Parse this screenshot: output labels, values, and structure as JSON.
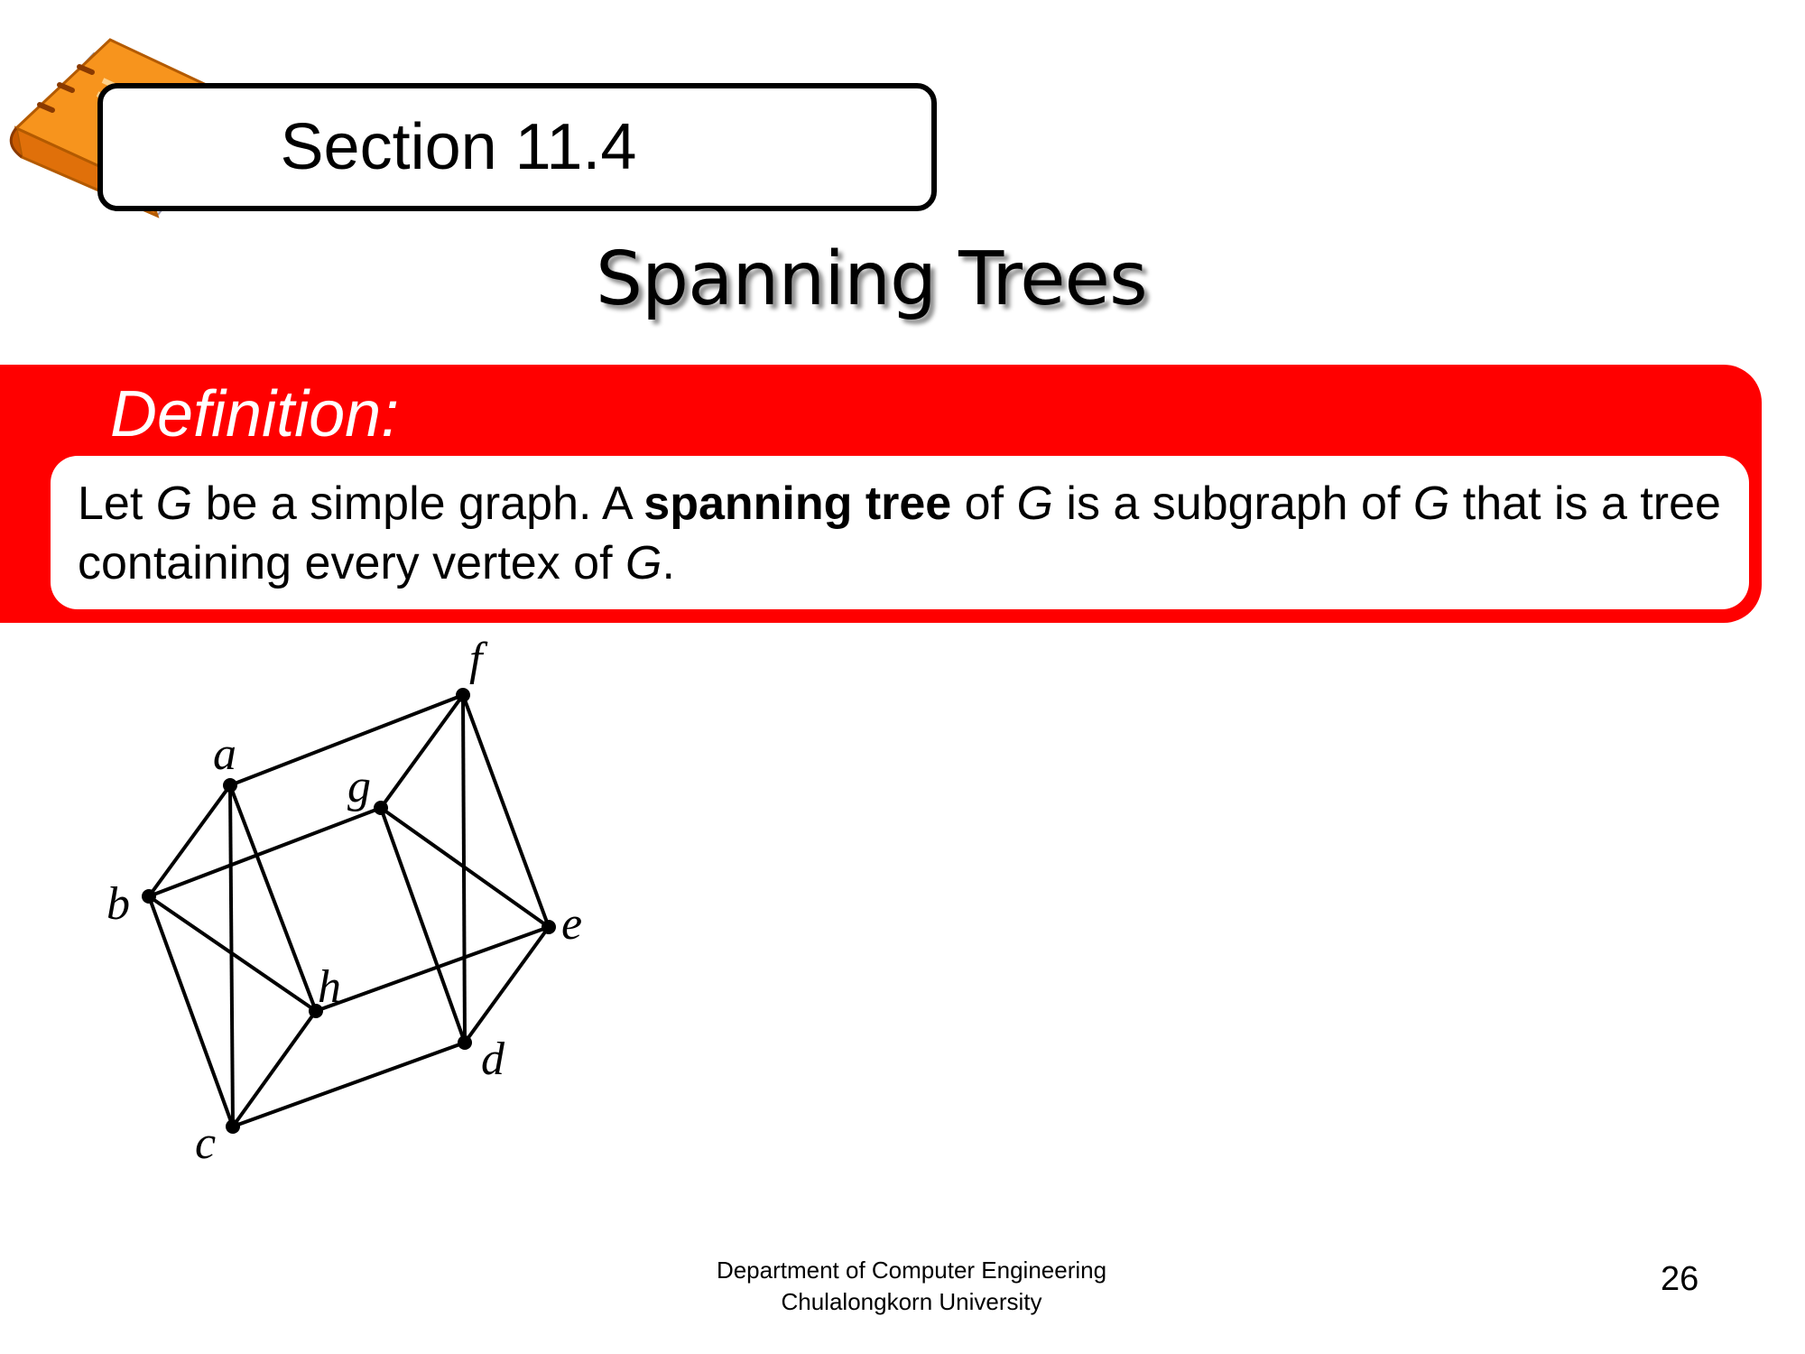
{
  "section_label": "Section 11.4",
  "title": "Spanning Trees",
  "definition": {
    "label": "Definition:",
    "text_parts": {
      "p1": "Let ",
      "g1": "G",
      "p2": " be a simple graph. A ",
      "term": "spanning tree",
      "p3": " of ",
      "g2": "G",
      "p4": " is a subgraph of ",
      "g3": "G",
      "p5": " that is a tree containing every vertex of ",
      "g4": "G",
      "p6": "."
    }
  },
  "graph": {
    "vertices": [
      "a",
      "b",
      "c",
      "d",
      "e",
      "f",
      "g",
      "h"
    ],
    "edges": [
      [
        "a",
        "f"
      ],
      [
        "a",
        "b"
      ],
      [
        "a",
        "c"
      ],
      [
        "a",
        "h"
      ],
      [
        "b",
        "g"
      ],
      [
        "b",
        "h"
      ],
      [
        "b",
        "c"
      ],
      [
        "c",
        "h"
      ],
      [
        "c",
        "d"
      ],
      [
        "d",
        "e"
      ],
      [
        "d",
        "f"
      ],
      [
        "d",
        "g"
      ],
      [
        "e",
        "f"
      ],
      [
        "e",
        "g"
      ],
      [
        "e",
        "h"
      ],
      [
        "f",
        "g"
      ]
    ]
  },
  "footer": {
    "line1": "Department of Computer Engineering",
    "line2": "Chulalongkorn University"
  },
  "page_number": "26",
  "colors": {
    "band": "#ff0000",
    "book_cover": "#f7941d",
    "book_pages": "#eeeef4"
  },
  "icons": {
    "book": "book-icon"
  }
}
